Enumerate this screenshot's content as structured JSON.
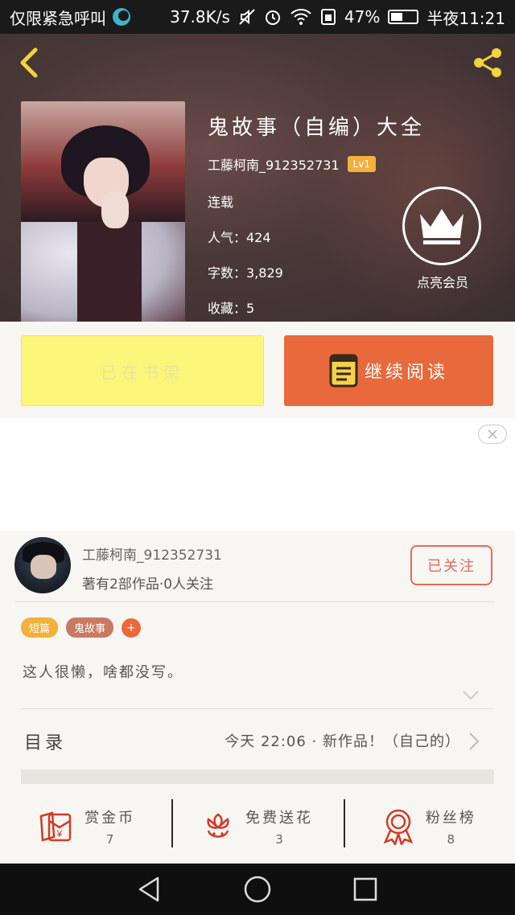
{
  "statusbar": {
    "carrier": "仅限紧急呼叫",
    "speed": "37.8K/s",
    "battery": "47%",
    "battery_level": 0.47,
    "time": "半夜11:21"
  },
  "book": {
    "title": "鬼故事（自编）大全",
    "author": "工藤柯南_912352731",
    "level": "Lv1",
    "status": "连载",
    "popularity": "人气：424",
    "word_count": "字数：3,829",
    "favorites": "收藏：5"
  },
  "vip": {
    "label": "点亮会员"
  },
  "buttons": {
    "shelf": "已在书架",
    "read": "继续阅读"
  },
  "author_card": {
    "name": "工藤柯南_912352731",
    "stats": "著有2部作品·0人关注",
    "follow": "已关注",
    "tags": [
      "短篇",
      "鬼故事"
    ],
    "tag_plus": "+",
    "bio": "这人很懒，啥都没写。"
  },
  "toc": {
    "label": "目录",
    "latest": "今天 22:06 · 新作品！（自己的）"
  },
  "actions": [
    {
      "label": "赏金币",
      "count": "7",
      "icon": "red-envelope-icon"
    },
    {
      "label": "免费送花",
      "count": "3",
      "icon": "flower-icon"
    },
    {
      "label": "粉丝榜",
      "count": "8",
      "icon": "medal-icon"
    }
  ],
  "colors": {
    "accent": "#e86a3c",
    "shelf_button": "#fbf67a",
    "level_badge": "#f3b03b",
    "icon_red": "#d23a2a",
    "tag_short": "#f3b03b",
    "tag_ghost": "#c97a60"
  }
}
